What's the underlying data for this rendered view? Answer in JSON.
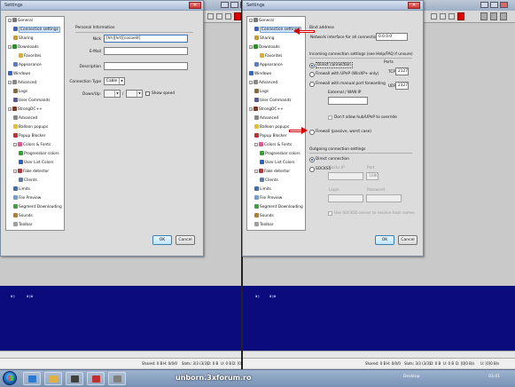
{
  "left": {
    "dialog_title": "Settings",
    "tree": [
      {
        "label": "General",
        "level": 0,
        "toggle": "−",
        "icon_color": "#7a7a7a"
      },
      {
        "label": "Connection settings",
        "level": 1,
        "selected": true,
        "icon_color": "#3a63c4"
      },
      {
        "label": "Sharing",
        "level": 1,
        "icon_color": "#c89b2a"
      },
      {
        "label": "Downloads",
        "level": 0,
        "toggle": "−",
        "icon_color": "#2e8b2e"
      },
      {
        "label": "Favorites",
        "level": 2,
        "icon_color": "#d8b030"
      },
      {
        "label": "Appearance",
        "level": 1,
        "icon_color": "#5a7fc4"
      },
      {
        "label": "Windows",
        "level": 0,
        "toggle": "",
        "icon_color": "#3a63c4"
      },
      {
        "label": "Advanced",
        "level": 0,
        "toggle": "−",
        "icon_color": "#888888"
      },
      {
        "label": "Logs",
        "level": 1,
        "icon_color": "#8a6a3a"
      },
      {
        "label": "User Commands",
        "level": 1,
        "icon_color": "#5a5a9a"
      },
      {
        "label": "StrongDC++",
        "level": 0,
        "toggle": "−",
        "icon_color": "#7a3a2a"
      },
      {
        "label": "Advanced",
        "level": 1,
        "icon_color": "#888888"
      },
      {
        "label": "Balloon popups",
        "level": 1,
        "icon_color": "#e0c030"
      },
      {
        "label": "Popup Blocker",
        "level": 1,
        "icon_color": "#c03030"
      },
      {
        "label": "Colors & Fonts",
        "level": 1,
        "toggle": "−",
        "icon_color": "#d06090"
      },
      {
        "label": "Progressbar colors",
        "level": 2,
        "icon_color": "#30a030"
      },
      {
        "label": "User List Colors",
        "level": 2,
        "icon_color": "#3060c0"
      },
      {
        "label": "Fake detector",
        "level": 1,
        "toggle": "−",
        "icon_color": "#a04040"
      },
      {
        "label": "Clients",
        "level": 2,
        "icon_color": "#6080a0"
      },
      {
        "label": "Limits",
        "level": 1,
        "icon_color": "#4070b0"
      },
      {
        "label": "File Preview",
        "level": 1,
        "icon_color": "#70a0d0"
      },
      {
        "label": "Segment Downloading",
        "level": 1,
        "icon_color": "#40a040"
      },
      {
        "label": "Sounds",
        "level": 1,
        "icon_color": "#b08030"
      },
      {
        "label": "Toolbar",
        "level": 1,
        "icon_color": "#a0a0a0"
      }
    ],
    "personal_info": {
      "group_title": "Personal Information",
      "nick_label": "Nick",
      "nick_value": "[hh][hrt][cocoelit]",
      "email_label": "E-Mail",
      "email_value": "",
      "description_label": "Description",
      "description_value": "",
      "conn_type_label": "Connection Type",
      "conn_type_value": "Cable",
      "down_up_label": "Down/Up:",
      "separator": "/",
      "show_speed_label": "Show speed"
    },
    "ok_label": "OK",
    "cancel_label": "Cancel"
  },
  "right": {
    "dialog_title": "Settings",
    "bind": {
      "group_title": "Bind address",
      "label": "Network interface for all connections",
      "value": "0.0.0.0"
    },
    "incoming": {
      "group_title": "Incoming connection settings (see Help/FAQ if unsure)",
      "direct_label": "Direct connection",
      "upnp_label": "Firewall with UPnP (WinXP+ only)",
      "manual_label": "Firewall with manual port forwarding",
      "passive_label": "Firewall (passive, worst case)",
      "ports_label": "Ports",
      "tcp_label": "TCP",
      "tcp_value": "21276",
      "udp_label": "UDP",
      "udp_value": "2327",
      "external_ip_label": "External / WAN IP",
      "external_ip_value": "",
      "no_override_label": "Don't allow hub/UPnP to override"
    },
    "outgoing": {
      "group_title": "Outgoing connection settings",
      "direct_label": "Direct connection",
      "socks_label": "SOCKS5",
      "socks_ip_label": "Socks IP",
      "port_label": "Port",
      "port_value": "1080",
      "login_label": "Login",
      "password_label": "Password",
      "resolve_label": "Use SOCKS5 server to resolve host names"
    },
    "ok_label": "OK",
    "cancel_label": "Cancel"
  },
  "status_left": [
    "Shared: 0 B",
    "H: 0/0/0",
    "Slots: 3/3 (3/3)",
    "D: 0 B",
    "U: 0 B",
    "D: [0]0 B/s"
  ],
  "status_right": [
    "Shared: 0 B",
    "H: 0/0/0",
    "Slots: 3/3 (3/3)",
    "D: 0 B",
    "U: 0 B",
    "D: [0]0 B/s",
    "U: [0]0 B/s"
  ],
  "tray": {
    "desktop_label": "Desktop",
    "time": "03:41"
  },
  "watermark": "unborn.3xforum.ro",
  "colors": {
    "arrow": "#dd0000",
    "bluepane": "#0b0b7e",
    "selected": "#cfe3fa"
  }
}
